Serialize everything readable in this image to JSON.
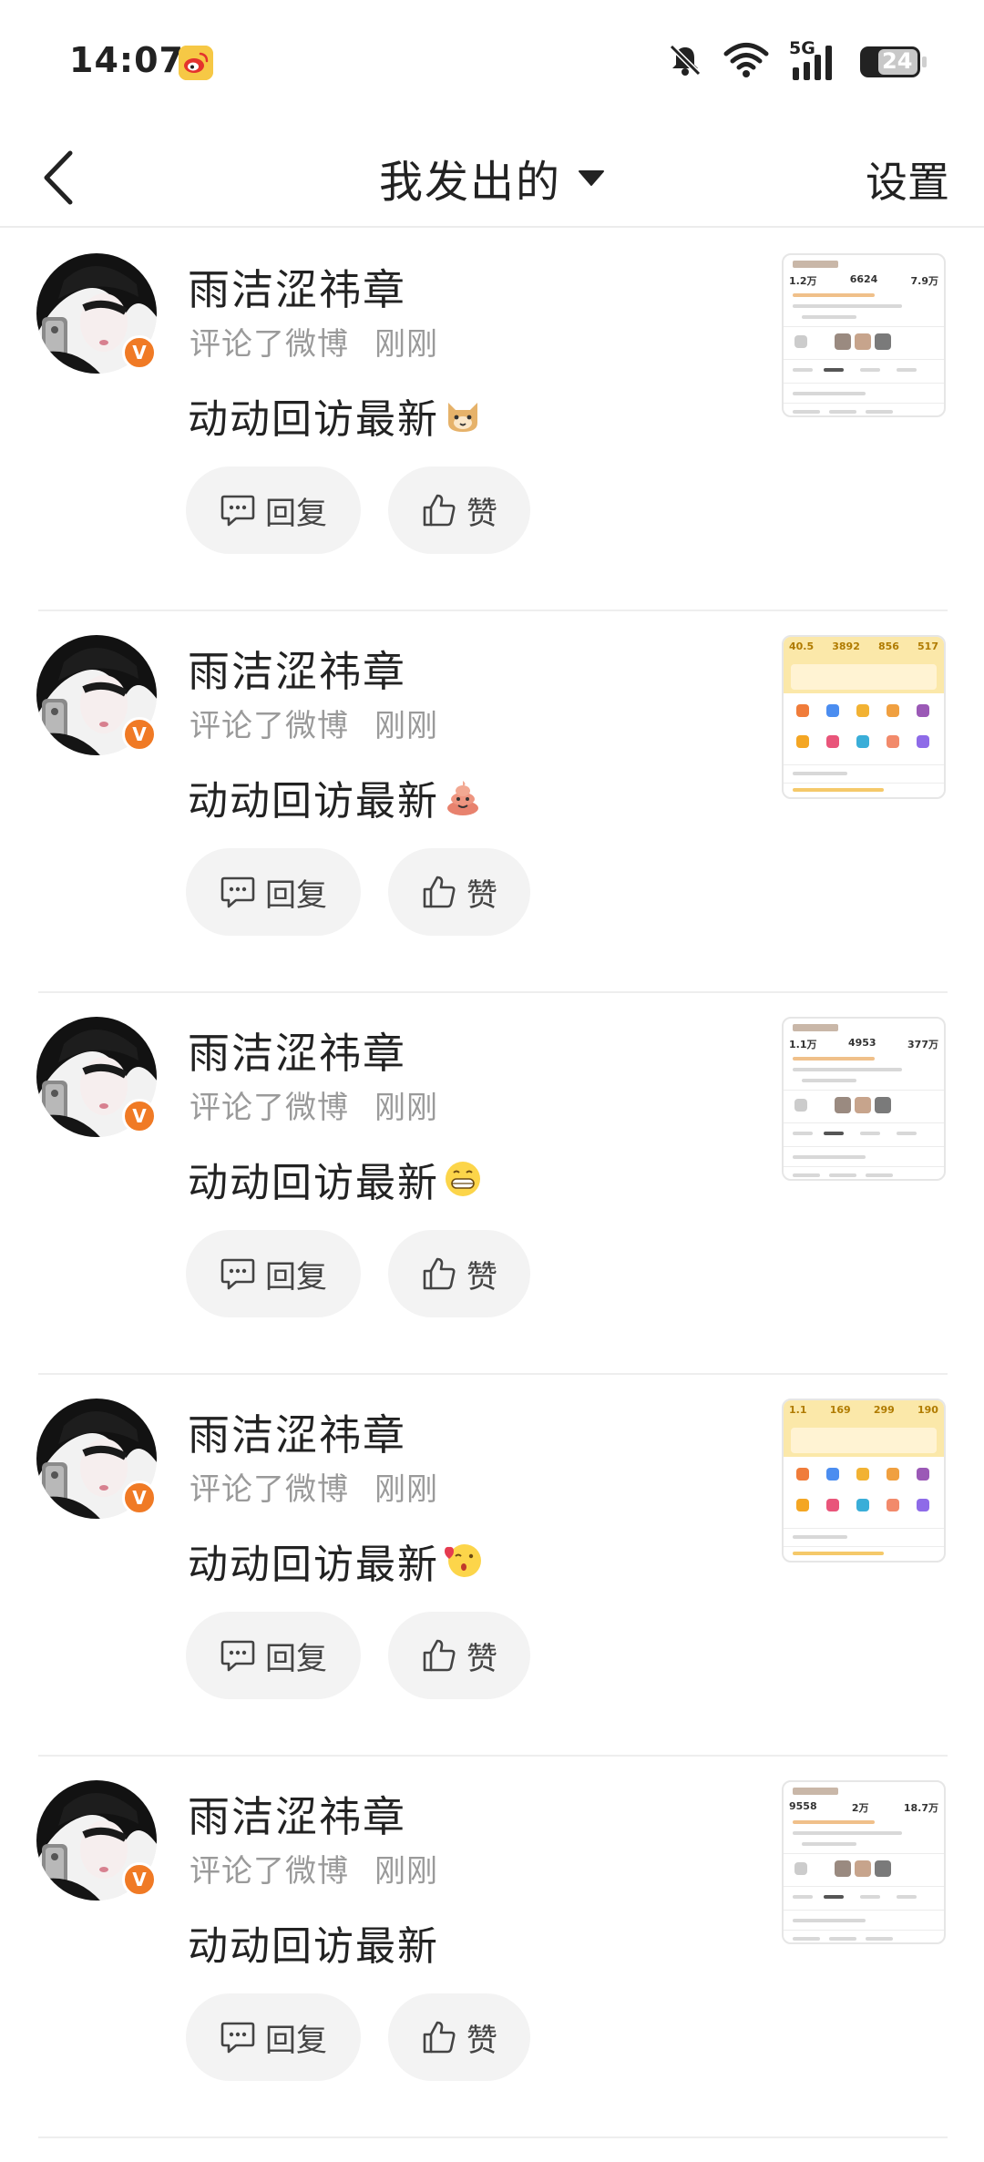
{
  "status_bar": {
    "time": "14:07",
    "icons": [
      "weibo-app-icon",
      "mute-bell-icon",
      "wifi-icon",
      "5g-signal-icon",
      "battery-icon"
    ],
    "network_label": "5G",
    "battery_level": "24"
  },
  "nav": {
    "back_icon": "chevron-left-icon",
    "title": "我发出的",
    "dropdown_icon": "caret-down-icon",
    "settings_label": "设置"
  },
  "colors": {
    "accent": "#f07a25",
    "divider": "#eeeeee",
    "meta_text": "#9a9a9a",
    "button_bg": "#f3f3f3"
  },
  "feed": {
    "items": [
      {
        "username": "雨洁涩祎章",
        "action": "评论了微博",
        "time": "刚刚",
        "content": "动动回访最新",
        "emoji": "cat-emoji",
        "reply_label": "回复",
        "like_label": "赞",
        "thumb_stats": [
          "1.2万",
          "6624",
          "7.9万"
        ]
      },
      {
        "username": "雨洁涩祎章",
        "action": "评论了微博",
        "time": "刚刚",
        "content": "动动回访最新",
        "emoji": "poop-emoji",
        "reply_label": "回复",
        "like_label": "赞",
        "thumb_stats": [
          "40.5",
          "3892",
          "856",
          "517"
        ]
      },
      {
        "username": "雨洁涩祎章",
        "action": "评论了微博",
        "time": "刚刚",
        "content": "动动回访最新",
        "emoji": "grin-emoji",
        "reply_label": "回复",
        "like_label": "赞",
        "thumb_stats": [
          "1.1万",
          "4953",
          "377万"
        ]
      },
      {
        "username": "雨洁涩祎章",
        "action": "评论了微博",
        "time": "刚刚",
        "content": "动动回访最新",
        "emoji": "kiss-emoji",
        "reply_label": "回复",
        "like_label": "赞",
        "thumb_stats": [
          "1.1",
          "169",
          "299",
          "190"
        ]
      },
      {
        "username": "雨洁涩祎章",
        "action": "评论了微博",
        "time": "刚刚",
        "content": "动动回访最新",
        "emoji": "",
        "reply_label": "回复",
        "like_label": "赞",
        "thumb_stats": [
          "9558",
          "2万",
          "18.7万"
        ]
      }
    ]
  }
}
